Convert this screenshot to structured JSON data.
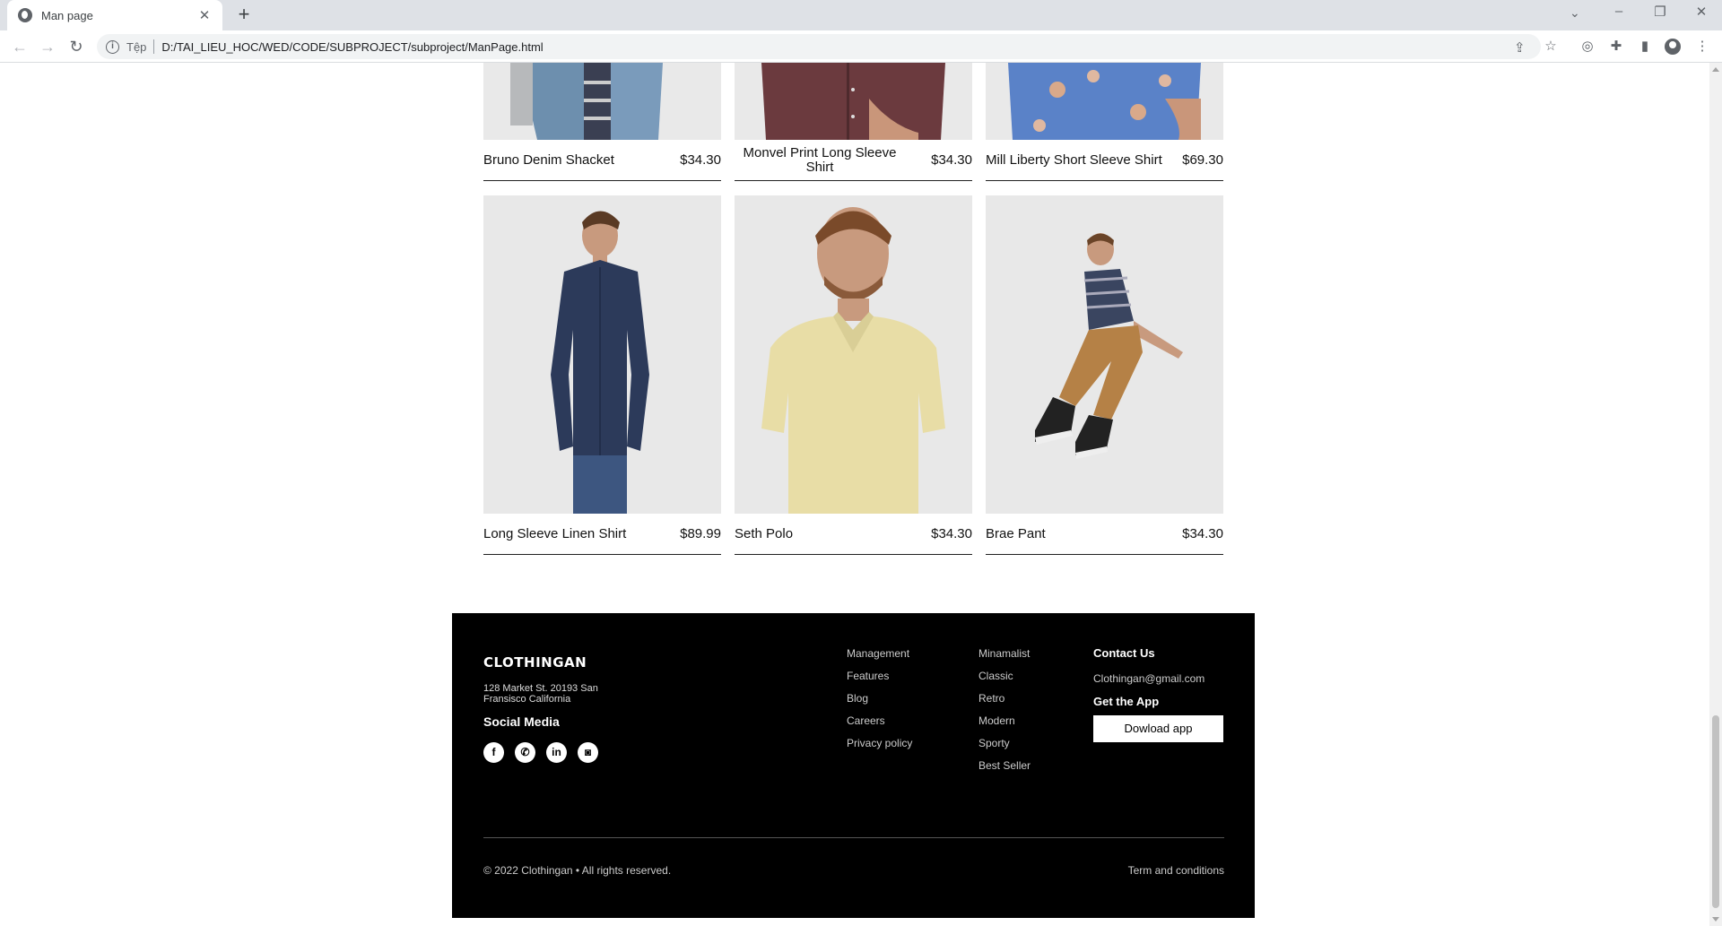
{
  "browser": {
    "tab_title": "Man page",
    "tab_close": "✕",
    "new_tab": "+",
    "scheme_label": "Tệp",
    "url": "D:/TAI_LIEU_HOC/WED/CODE/SUBPROJECT/subproject/ManPage.html"
  },
  "products_top": [
    {
      "name": "Bruno Denim Shacket",
      "price": "$34.30"
    },
    {
      "name": "Monvel Print Long Sleeve Shirt",
      "price": "$34.30"
    },
    {
      "name": "Mill Liberty Short Sleeve Shirt",
      "price": "$69.30"
    }
  ],
  "products_bottom": [
    {
      "name": "Long Sleeve Linen Shirt",
      "price": "$89.99"
    },
    {
      "name": "Seth Polo",
      "price": "$34.30"
    },
    {
      "name": "Brae Pant",
      "price": "$34.30"
    }
  ],
  "footer": {
    "brand": "CLOTHINGAN",
    "address": "128 Market St. 20193 San Fransisco California",
    "social_title": "Social Media",
    "social_icons": [
      "f",
      "w",
      "in",
      "ig"
    ],
    "links_col1": [
      "Management",
      "Features",
      "Blog",
      "Careers",
      "Privacy policy"
    ],
    "links_col2": [
      "Minamalist",
      "Classic",
      "Retro",
      "Modern",
      "Sporty",
      "Best Seller"
    ],
    "contact_title": "Contact Us",
    "contact_email": "Clothingan@gmail.com",
    "app_title": "Get the App",
    "download_label": "Dowload app",
    "copyright": "© 2022 Clothingan • All rights reserved.",
    "terms": "Term and conditions"
  }
}
